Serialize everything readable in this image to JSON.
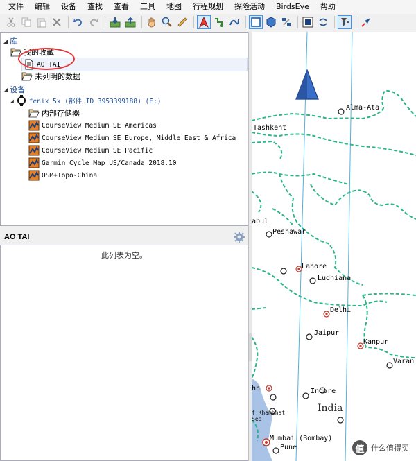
{
  "menu": [
    "文件",
    "编辑",
    "设备",
    "查找",
    "查看",
    "工具",
    "地图",
    "行程规划",
    "探险活动",
    "BirdsEye",
    "帮助"
  ],
  "toolbar": {
    "buttons": [
      "cut-icon",
      "copy-icon",
      "paste-icon",
      "delete-icon",
      "undo-icon",
      "redo-icon",
      "receive-from-device-icon",
      "send-to-device-icon",
      "hand-tool-icon",
      "zoom-tool-icon",
      "measure-tool-icon",
      "route-tool-icon",
      "waypoint-tool-icon",
      "profile-tool-icon",
      "map-view-icon",
      "3d-view-icon",
      "satellite-view-icon",
      "overlay-icon",
      "sync-icon",
      "filter-icon",
      "launch-icon"
    ]
  },
  "tree": {
    "library_label": "库",
    "my_collection": "我的收藏",
    "ao_tai": "AO TAI",
    "unlisted": "未列明的数据",
    "devices_label": "设备",
    "device_name": "fenix 5x (部件 ID 3953399188) (E:)",
    "internal_storage": "内部存储器",
    "maps": [
      "CourseView Medium SE Americas",
      "CourseView Medium SE Europe, Middle East & Africa",
      "CourseView Medium SE Pacific",
      "Garmin Cycle Map US/Canada 2018.10",
      "OSM+Topo-China"
    ]
  },
  "details": {
    "title": "AO TAI",
    "empty_text": "此列表为空。"
  },
  "map": {
    "cities": [
      "Alma-Ata",
      "Tashkent",
      "abul",
      "Peshawar",
      "Lahore",
      "Ludhiana",
      "Delhi",
      "Jaipur",
      "Kanpur",
      "Varan",
      "Indore",
      "Mumbai (Bombay)",
      "Pune",
      "hh"
    ],
    "country": "India",
    "sea": [
      "f Khambhat",
      "Sea"
    ]
  },
  "watermark": {
    "logo": "值",
    "text": "什么值得买"
  },
  "colors": {
    "border_dash": "#2bb58a",
    "grid": "#4fb3d9",
    "water": "#a9c3e6",
    "triangle": "#3a6fc9",
    "annotation": "#e0383a"
  }
}
